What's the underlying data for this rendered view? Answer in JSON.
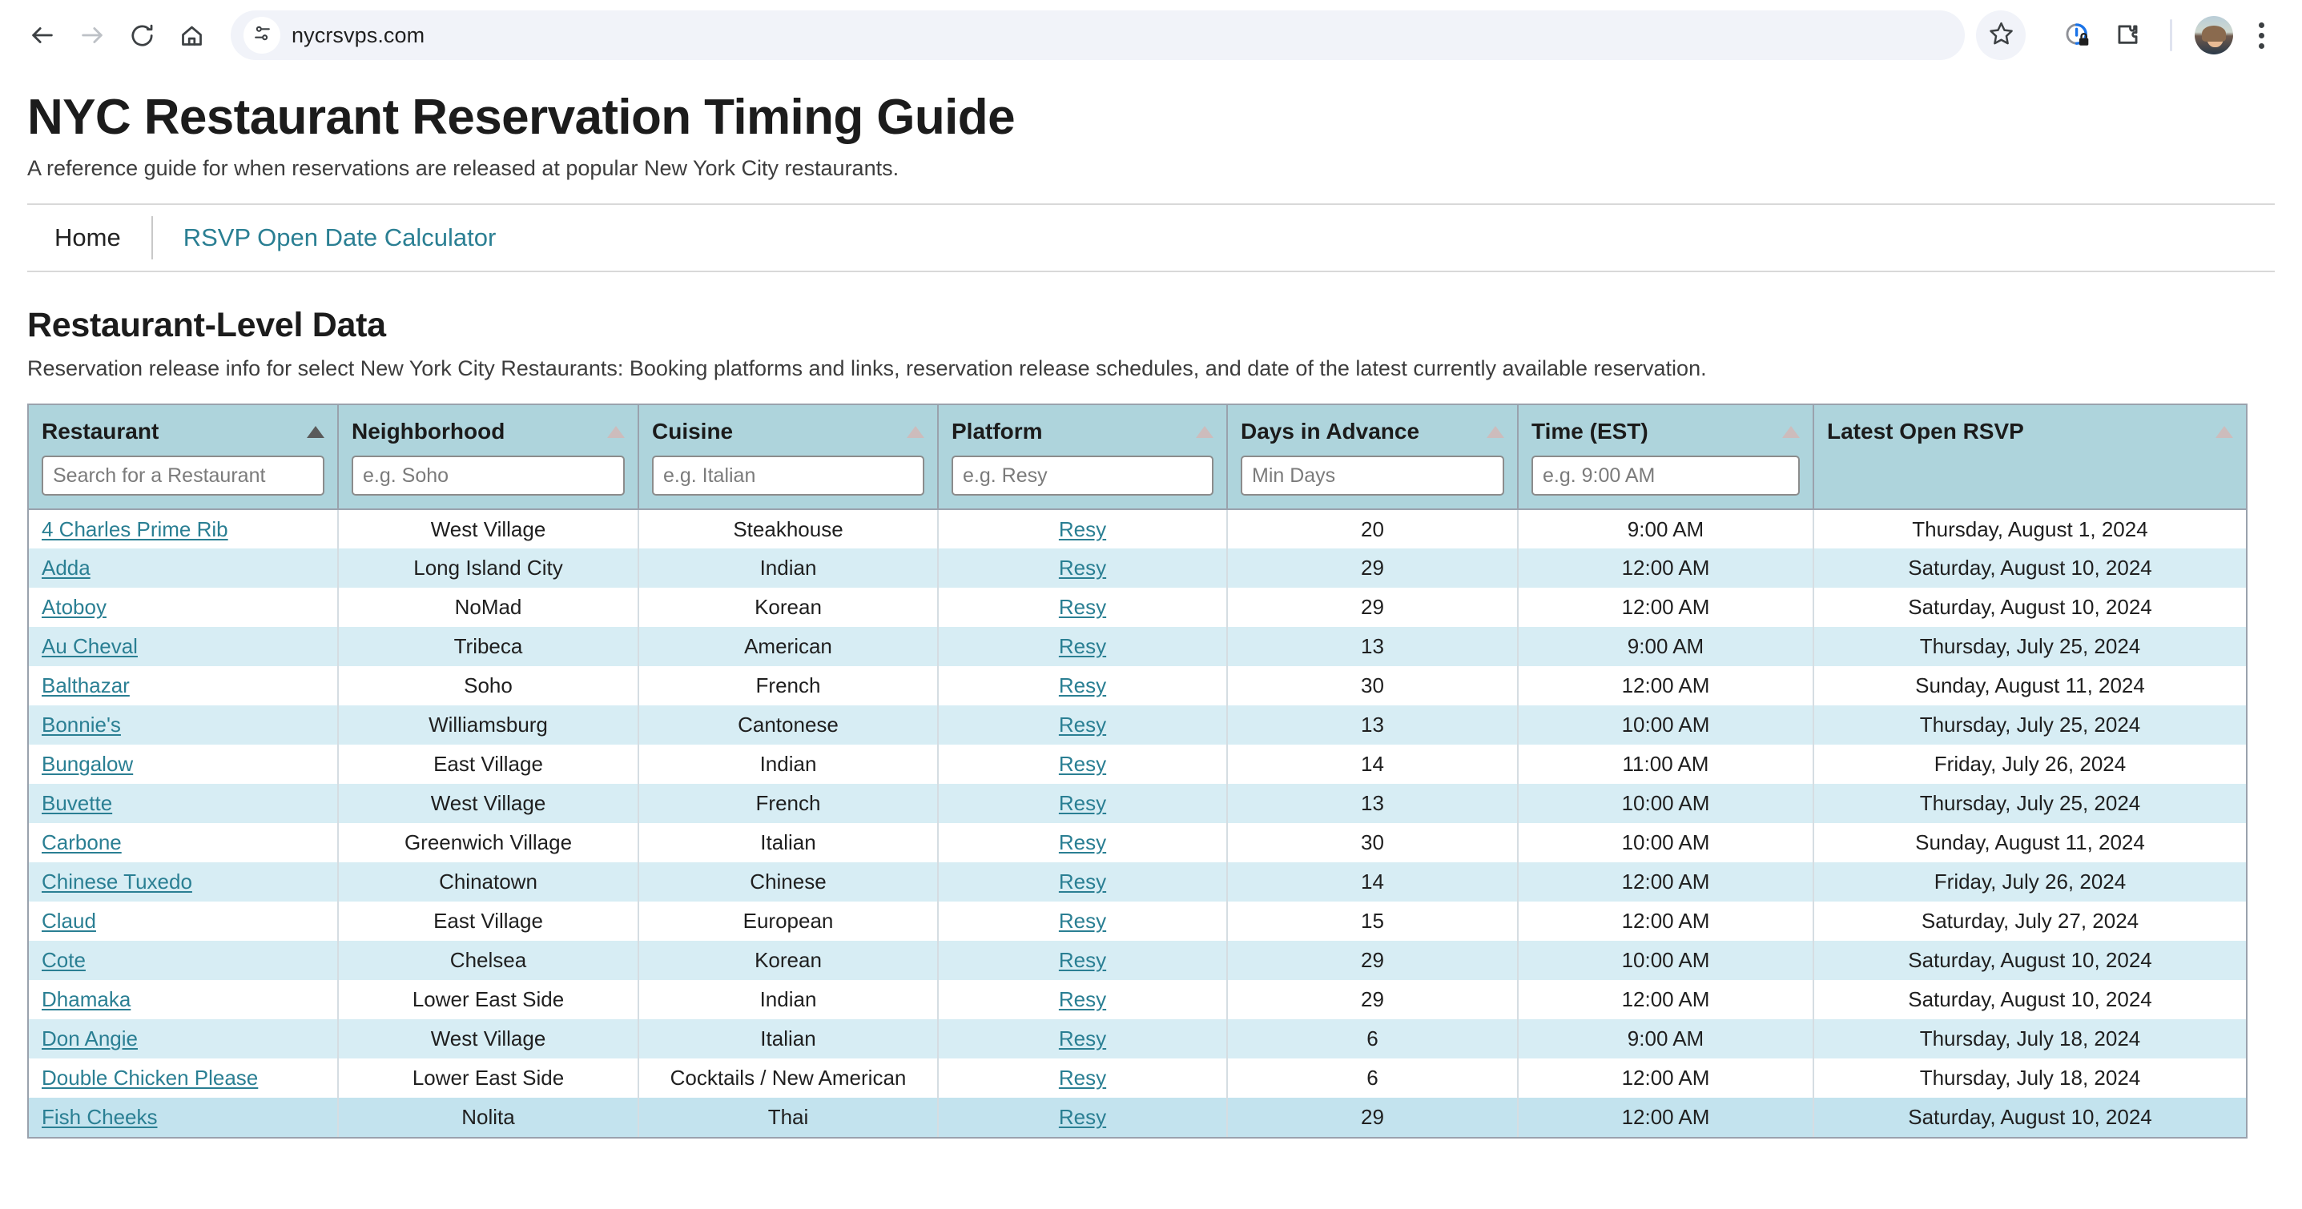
{
  "browser": {
    "back_icon": "back-arrow-icon",
    "forward_icon": "forward-arrow-icon",
    "reload_icon": "reload-icon",
    "home_icon": "home-icon",
    "site_settings_icon": "site-settings-sliders-icon",
    "url": "nycrsvps.com",
    "bookmark_icon": "star-icon",
    "tracking_icon": "tracking-protection-lock-icon",
    "extensions_icon": "extensions-puzzle-icon",
    "profile_icon": "profile-avatar",
    "menu_icon": "kebab-menu-icon"
  },
  "header": {
    "title": "NYC Restaurant Reservation Timing Guide",
    "subtitle": "A reference guide for when reservations are released at popular New York City restaurants."
  },
  "nav": {
    "home_label": "Home",
    "calculator_label": "RSVP Open Date Calculator",
    "link_color": "#2a7f93"
  },
  "section": {
    "title": "Restaurant-Level Data",
    "description": "Reservation release info for select New York City Restaurants: Booking platforms and links, reservation release schedules, and date of the latest currently available reservation."
  },
  "table": {
    "colors": {
      "header_bg": "#aed4dc",
      "row_alt_bg": "#d7edf4",
      "row_hover_bg": "#c3e3ee",
      "border": "#9aa2ad",
      "link": "#2a7f93"
    },
    "columns": [
      {
        "key": "restaurant",
        "label": "Restaurant",
        "sortable": true,
        "sort_active": true,
        "filter": true,
        "placeholder": "Search for a Restaurant"
      },
      {
        "key": "neighborhood",
        "label": "Neighborhood",
        "sortable": true,
        "sort_active": false,
        "filter": true,
        "placeholder": "e.g. Soho"
      },
      {
        "key": "cuisine",
        "label": "Cuisine",
        "sortable": true,
        "sort_active": false,
        "filter": true,
        "placeholder": "e.g. Italian"
      },
      {
        "key": "platform",
        "label": "Platform",
        "sortable": true,
        "sort_active": false,
        "filter": true,
        "placeholder": "e.g. Resy"
      },
      {
        "key": "days",
        "label": "Days in Advance",
        "sortable": true,
        "sort_active": false,
        "filter": true,
        "placeholder": "Min Days"
      },
      {
        "key": "time",
        "label": "Time (EST)",
        "sortable": true,
        "sort_active": false,
        "filter": true,
        "placeholder": "e.g. 9:00 AM"
      },
      {
        "key": "rsvp",
        "label": "Latest Open RSVP",
        "sortable": true,
        "sort_active": false,
        "filter": false,
        "placeholder": ""
      }
    ],
    "rows": [
      {
        "restaurant": "4 Charles Prime Rib",
        "neighborhood": "West Village",
        "cuisine": "Steakhouse",
        "platform": "Resy",
        "days": "20",
        "time": "9:00 AM",
        "rsvp": "Thursday, August 1, 2024"
      },
      {
        "restaurant": "Adda",
        "neighborhood": "Long Island City",
        "cuisine": "Indian",
        "platform": "Resy",
        "days": "29",
        "time": "12:00 AM",
        "rsvp": "Saturday, August 10, 2024"
      },
      {
        "restaurant": "Atoboy",
        "neighborhood": "NoMad",
        "cuisine": "Korean",
        "platform": "Resy",
        "days": "29",
        "time": "12:00 AM",
        "rsvp": "Saturday, August 10, 2024"
      },
      {
        "restaurant": "Au Cheval",
        "neighborhood": "Tribeca",
        "cuisine": "American",
        "platform": "Resy",
        "days": "13",
        "time": "9:00 AM",
        "rsvp": "Thursday, July 25, 2024"
      },
      {
        "restaurant": "Balthazar",
        "neighborhood": "Soho",
        "cuisine": "French",
        "platform": "Resy",
        "days": "30",
        "time": "12:00 AM",
        "rsvp": "Sunday, August 11, 2024"
      },
      {
        "restaurant": "Bonnie's",
        "neighborhood": "Williamsburg",
        "cuisine": "Cantonese",
        "platform": "Resy",
        "days": "13",
        "time": "10:00 AM",
        "rsvp": "Thursday, July 25, 2024"
      },
      {
        "restaurant": "Bungalow",
        "neighborhood": "East Village",
        "cuisine": "Indian",
        "platform": "Resy",
        "days": "14",
        "time": "11:00 AM",
        "rsvp": "Friday, July 26, 2024"
      },
      {
        "restaurant": "Buvette",
        "neighborhood": "West Village",
        "cuisine": "French",
        "platform": "Resy",
        "days": "13",
        "time": "10:00 AM",
        "rsvp": "Thursday, July 25, 2024"
      },
      {
        "restaurant": "Carbone",
        "neighborhood": "Greenwich Village",
        "cuisine": "Italian",
        "platform": "Resy",
        "days": "30",
        "time": "10:00 AM",
        "rsvp": "Sunday, August 11, 2024"
      },
      {
        "restaurant": "Chinese Tuxedo",
        "neighborhood": "Chinatown",
        "cuisine": "Chinese",
        "platform": "Resy",
        "days": "14",
        "time": "12:00 AM",
        "rsvp": "Friday, July 26, 2024"
      },
      {
        "restaurant": "Claud",
        "neighborhood": "East Village",
        "cuisine": "European",
        "platform": "Resy",
        "days": "15",
        "time": "12:00 AM",
        "rsvp": "Saturday, July 27, 2024"
      },
      {
        "restaurant": "Cote",
        "neighborhood": "Chelsea",
        "cuisine": "Korean",
        "platform": "Resy",
        "days": "29",
        "time": "10:00 AM",
        "rsvp": "Saturday, August 10, 2024"
      },
      {
        "restaurant": "Dhamaka",
        "neighborhood": "Lower East Side",
        "cuisine": "Indian",
        "platform": "Resy",
        "days": "29",
        "time": "12:00 AM",
        "rsvp": "Saturday, August 10, 2024"
      },
      {
        "restaurant": "Don Angie",
        "neighborhood": "West Village",
        "cuisine": "Italian",
        "platform": "Resy",
        "days": "6",
        "time": "9:00 AM",
        "rsvp": "Thursday, July 18, 2024"
      },
      {
        "restaurant": "Double Chicken Please",
        "neighborhood": "Lower East Side",
        "cuisine": "Cocktails / New American",
        "platform": "Resy",
        "days": "6",
        "time": "12:00 AM",
        "rsvp": "Thursday, July 18, 2024"
      },
      {
        "restaurant": "Fish Cheeks",
        "neighborhood": "Nolita",
        "cuisine": "Thai",
        "platform": "Resy",
        "days": "29",
        "time": "12:00 AM",
        "rsvp": "Saturday, August 10, 2024"
      }
    ]
  }
}
